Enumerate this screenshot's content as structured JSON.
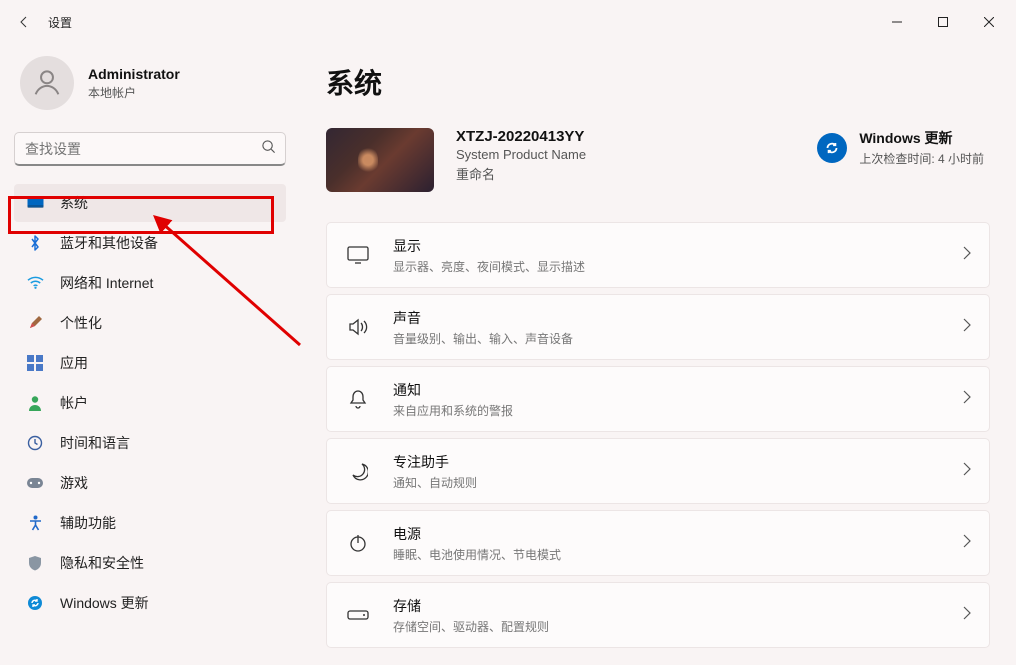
{
  "window": {
    "title": "设置"
  },
  "account": {
    "name": "Administrator",
    "subtitle": "本地帐户"
  },
  "search": {
    "placeholder": "查找设置"
  },
  "nav": {
    "items": [
      {
        "label": "系统"
      },
      {
        "label": "蓝牙和其他设备"
      },
      {
        "label": "网络和 Internet"
      },
      {
        "label": "个性化"
      },
      {
        "label": "应用"
      },
      {
        "label": "帐户"
      },
      {
        "label": "时间和语言"
      },
      {
        "label": "游戏"
      },
      {
        "label": "辅助功能"
      },
      {
        "label": "隐私和安全性"
      },
      {
        "label": "Windows 更新"
      }
    ]
  },
  "page": {
    "title": "系统",
    "system": {
      "device_name": "XTZJ-20220413YY",
      "product_name": "System Product Name",
      "rename_label": "重命名"
    },
    "update": {
      "title": "Windows 更新",
      "subtitle": "上次检查时间: 4 小时前"
    },
    "cards": [
      {
        "title": "显示",
        "subtitle": "显示器、亮度、夜间模式、显示描述"
      },
      {
        "title": "声音",
        "subtitle": "音量级别、输出、输入、声音设备"
      },
      {
        "title": "通知",
        "subtitle": "来自应用和系统的警报"
      },
      {
        "title": "专注助手",
        "subtitle": "通知、自动规则"
      },
      {
        "title": "电源",
        "subtitle": "睡眠、电池使用情况、节电模式"
      },
      {
        "title": "存储",
        "subtitle": "存储空间、驱动器、配置规则"
      }
    ]
  }
}
